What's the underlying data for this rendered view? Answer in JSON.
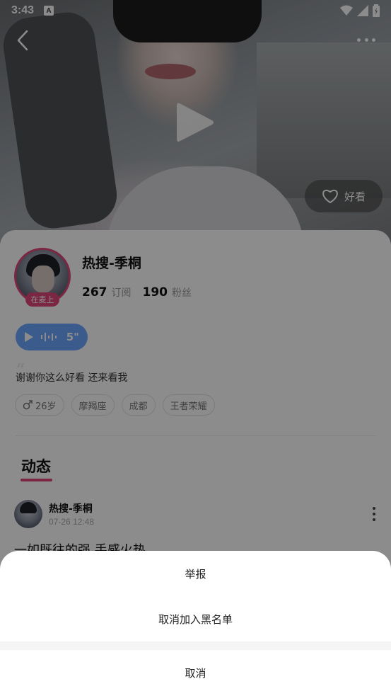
{
  "status_bar": {
    "time": "3:43",
    "notification_badge": "A"
  },
  "video": {
    "like_label": "好看"
  },
  "profile": {
    "name": "热搜-季桐",
    "mic_badge": "在麦上",
    "subscriptions_count": "267",
    "subscriptions_label": "订阅",
    "fans_count": "190",
    "fans_label": "粉丝",
    "voice_duration": "5\"",
    "bio": "谢谢你这么好看 还来看我",
    "tags": [
      "26岁",
      "摩羯座",
      "成都",
      "王者荣耀"
    ]
  },
  "feed": {
    "tab_label": "动态",
    "post": {
      "author": "热搜-季桐",
      "time": "07-26 12:48",
      "text": "一如既往的强 手感火热"
    }
  },
  "sheet": {
    "report_label": "举报",
    "unblock_label": "取消加入黑名单",
    "cancel_label": "取消"
  },
  "colors": {
    "accent": "#e0487a",
    "voice": "#6aa6ff",
    "overlay": "rgba(0,0,0,0.45)"
  },
  "icons": [
    "back-icon",
    "more-icon",
    "play-icon",
    "heart-icon",
    "male-icon",
    "wifi-icon",
    "signal-icon",
    "battery-icon"
  ]
}
